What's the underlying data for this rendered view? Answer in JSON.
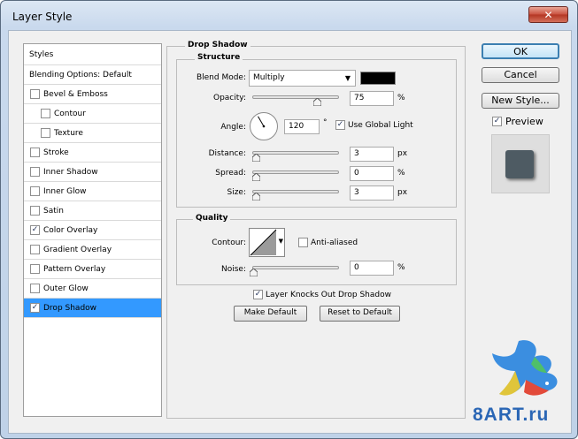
{
  "window": {
    "title": "Layer Style",
    "close_icon": "close-icon"
  },
  "styles_list": {
    "header": "Styles",
    "blending": "Blending Options: Default",
    "items": [
      {
        "label": "Bevel & Emboss",
        "checked": false,
        "indent": false
      },
      {
        "label": "Contour",
        "checked": false,
        "indent": true
      },
      {
        "label": "Texture",
        "checked": false,
        "indent": true
      },
      {
        "label": "Stroke",
        "checked": false,
        "indent": false
      },
      {
        "label": "Inner Shadow",
        "checked": false,
        "indent": false
      },
      {
        "label": "Inner Glow",
        "checked": false,
        "indent": false
      },
      {
        "label": "Satin",
        "checked": false,
        "indent": false
      },
      {
        "label": "Color Overlay",
        "checked": true,
        "indent": false
      },
      {
        "label": "Gradient Overlay",
        "checked": false,
        "indent": false
      },
      {
        "label": "Pattern Overlay",
        "checked": false,
        "indent": false
      },
      {
        "label": "Outer Glow",
        "checked": false,
        "indent": false
      },
      {
        "label": "Drop Shadow",
        "checked": true,
        "indent": false,
        "selected": true
      }
    ]
  },
  "drop_shadow": {
    "panel_title": "Drop Shadow",
    "structure_title": "Structure",
    "blend_mode_label": "Blend Mode:",
    "blend_mode_value": "Multiply",
    "shadow_color": "#000000",
    "opacity_label": "Opacity:",
    "opacity_value": "75",
    "opacity_fraction": 0.75,
    "percent": "%",
    "angle_label": "Angle:",
    "angle_value": "120",
    "degree": "°",
    "use_global_light": "Use Global Light",
    "use_global_light_checked": true,
    "distance_label": "Distance:",
    "distance_value": "3",
    "px": "px",
    "spread_label": "Spread:",
    "spread_value": "0",
    "size_label": "Size:",
    "size_value": "3"
  },
  "quality": {
    "title": "Quality",
    "contour_label": "Contour:",
    "anti_aliased": "Anti-aliased",
    "anti_aliased_checked": false,
    "noise_label": "Noise:",
    "noise_value": "0",
    "percent": "%"
  },
  "knockout": {
    "label": "Layer Knocks Out Drop Shadow",
    "checked": true
  },
  "make_default": "Make Default",
  "reset_default": "Reset to Default",
  "buttons": {
    "ok": "OK",
    "cancel": "Cancel",
    "new_style": "New Style...",
    "preview": "Preview",
    "preview_checked": true
  },
  "preview_swatch_color": "#4e5b63",
  "watermark": {
    "text": "8ART.ru"
  }
}
